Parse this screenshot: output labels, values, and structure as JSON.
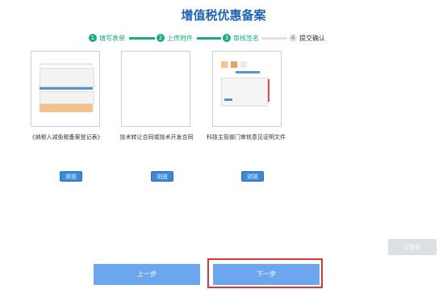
{
  "page": {
    "title": "增值税优惠备案"
  },
  "steps": [
    {
      "num": "1",
      "label": "填写表单",
      "state": "done"
    },
    {
      "num": "2",
      "label": "上传附件",
      "state": "done"
    },
    {
      "num": "3",
      "label": "审核签名",
      "state": "done"
    },
    {
      "num": "4",
      "label": "提交确认",
      "state": "pending"
    }
  ],
  "documents": [
    {
      "caption": "《纳税人减免税备案登记表》",
      "browse_label": "浏览"
    },
    {
      "caption": "技术转让合同或技术开发合同",
      "browse_label": "浏览"
    },
    {
      "caption": "科技主管部门审核意见证明文件",
      "browse_label": "浏览"
    }
  ],
  "buttons": {
    "signed": "已签名",
    "prev": "上一步",
    "next": "下一步"
  },
  "colors": {
    "title": "#1e63b8",
    "step_active": "#1aa886",
    "step_pending": "#e2e2e2",
    "primary_button": "#6ca6ef",
    "browse_button": "#3a8ad9",
    "highlight": "#d83a3a"
  }
}
